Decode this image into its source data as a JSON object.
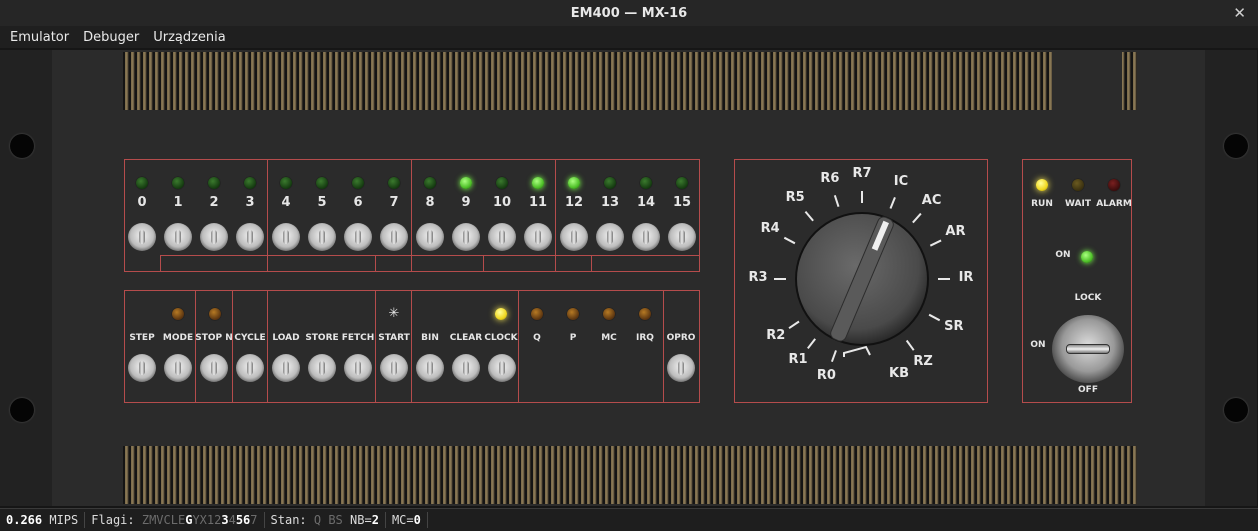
{
  "window": {
    "title": "EM400 — MX-16"
  },
  "menu": [
    "Emulator",
    "Debuger",
    "Urządzenia"
  ],
  "bits": [
    "0",
    "1",
    "2",
    "3",
    "4",
    "5",
    "6",
    "7",
    "8",
    "9",
    "10",
    "11",
    "12",
    "13",
    "14",
    "15"
  ],
  "bit_leds_on": [
    9,
    11,
    12
  ],
  "controls": {
    "step": "STEP",
    "mode": "MODE",
    "stopn": "STOP N",
    "cycle": "CYCLE",
    "load": "LOAD",
    "store": "STORE",
    "fetch": "FETCH",
    "start_sym": "✳",
    "start": "START",
    "bin": "BIN",
    "clear": "CLEAR",
    "clock": "CLOCK",
    "q": "Q",
    "p": "P",
    "mc": "MC",
    "irq": "IRQ",
    "opro": "OPRO"
  },
  "dial": {
    "labels": [
      "R0",
      "R1",
      "R2",
      "R3",
      "R4",
      "R5",
      "R6",
      "R7",
      "IC",
      "AC",
      "AR",
      "IR",
      "SR",
      "RZ",
      "KB"
    ]
  },
  "status_panel": {
    "run": "RUN",
    "wait": "WAIT",
    "alarm": "ALARM",
    "on_led": "ON",
    "lock": "LOCK",
    "key_on": "ON",
    "key_off": "OFF"
  },
  "colors": {
    "accent_line": "#b54c4c",
    "led_green_on": "#4ec028",
    "led_yellow_on": "#f0d820"
  },
  "statusbar": {
    "mips_value": "0.266",
    "mips_unit": "MIPS",
    "flags_label": "Flagi:",
    "flags_dim1": "ZMVCLE",
    "flags_bright1": "G",
    "flags_dim2": "YX12",
    "flags_bright2": "3",
    "flags_dim3": "4",
    "flags_bright3": "56",
    "flags_dim4": "7",
    "stan_label": "Stan:",
    "stan_dim": "Q BS",
    "nb_label": "NB=",
    "nb_value": "2",
    "mc_label": "MC=",
    "mc_value": "0"
  }
}
